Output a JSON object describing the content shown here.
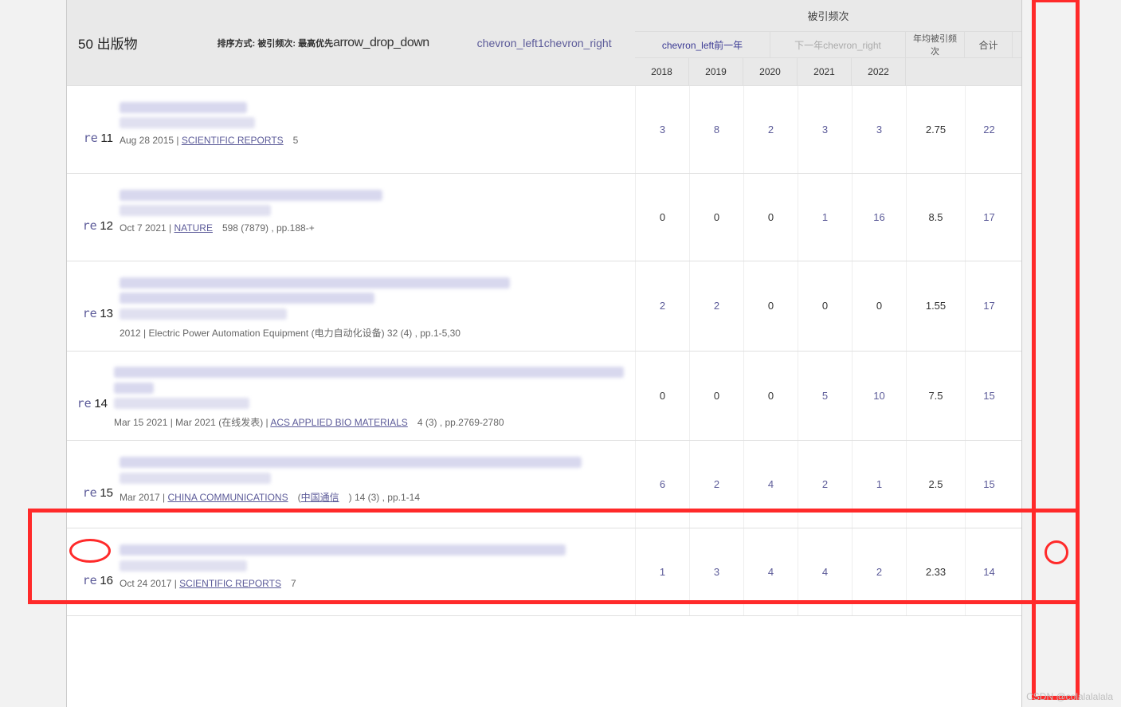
{
  "header": {
    "publications_title": "50 出版物",
    "sort_label": "排序方式: 被引频次: 最高优先",
    "sort_icon_word": "arrow_drop_down",
    "nav_left_word_1": "chevron_left",
    "nav_mid_word": "1",
    "nav_right_word_1": "chevron_right",
    "cite_header_title": "被引频次",
    "prev_year_word": "chevron_left前一年",
    "next_year_word": "下一年chevron_right",
    "avg_label": "年均被引频次",
    "sum_label": "合计",
    "years": [
      "2018",
      "2019",
      "2020",
      "2021",
      "2022"
    ]
  },
  "rows": [
    {
      "re": "re",
      "idx": "11",
      "meta_date": "Aug 28 2015 | ",
      "meta_journal": "SCIENTIFIC REPORTS",
      "meta_extra": "5",
      "meta_after": "",
      "title_widths": [
        160
      ],
      "author_widths": [
        170
      ],
      "cites": [
        "3",
        "8",
        "2",
        "3",
        "3"
      ],
      "avg": "2.75",
      "sum": "22"
    },
    {
      "re": "re",
      "idx": "12",
      "meta_date": "Oct 7 2021 | ",
      "meta_journal": "NATURE",
      "meta_extra": "598 (7879) , pp.188-+",
      "meta_after": "",
      "title_widths": [
        330
      ],
      "author_widths": [
        190
      ],
      "cites": [
        "0",
        "0",
        "0",
        "1",
        "16"
      ],
      "avg": "8.5",
      "sum": "17"
    },
    {
      "re": "re",
      "idx": "13",
      "meta_date": "2012 | ",
      "meta_journal_plain": "Electric Power Automation Equipment (电力自动化设备) 32 (4) , pp.1-5,30",
      "title_widths": [
        490,
        320
      ],
      "author_widths": [
        210
      ],
      "cites": [
        "2",
        "2",
        "0",
        "0",
        "0"
      ],
      "avg": "1.55",
      "sum": "17"
    },
    {
      "re": "re",
      "idx": "14",
      "meta_date": "Mar 15 2021 | Mar 2021 (在线发表) | ",
      "meta_journal": "ACS APPLIED BIO MATERIALS",
      "meta_extra": "4 (3) , pp.2769-2780",
      "title_widths": [
        640,
        50
      ],
      "author_widths": [
        170
      ],
      "cites": [
        "0",
        "0",
        "0",
        "5",
        "10"
      ],
      "avg": "7.5",
      "sum": "15"
    },
    {
      "re": "re",
      "idx": "15",
      "meta_date": "Mar 2017 | ",
      "meta_journal": "CHINA COMMUNICATIONS",
      "meta_cn_link": "中国通信",
      "meta_extra": ") 14 (3) , pp.1-14",
      "meta_open_paren": "(",
      "title_widths": [
        580
      ],
      "author_widths": [
        190
      ],
      "cites": [
        "6",
        "2",
        "4",
        "2",
        "1"
      ],
      "avg": "2.5",
      "sum": "15"
    },
    {
      "re": "re",
      "idx": "16",
      "meta_date": "Oct 24 2017 | ",
      "meta_journal": "SCIENTIFIC REPORTS",
      "meta_extra": "7",
      "title_widths": [
        560
      ],
      "author_widths": [
        160
      ],
      "cites": [
        "1",
        "3",
        "4",
        "4",
        "2"
      ],
      "avg": "2.33",
      "sum": "14"
    }
  ],
  "watermark": "CSDN @colalalalala"
}
